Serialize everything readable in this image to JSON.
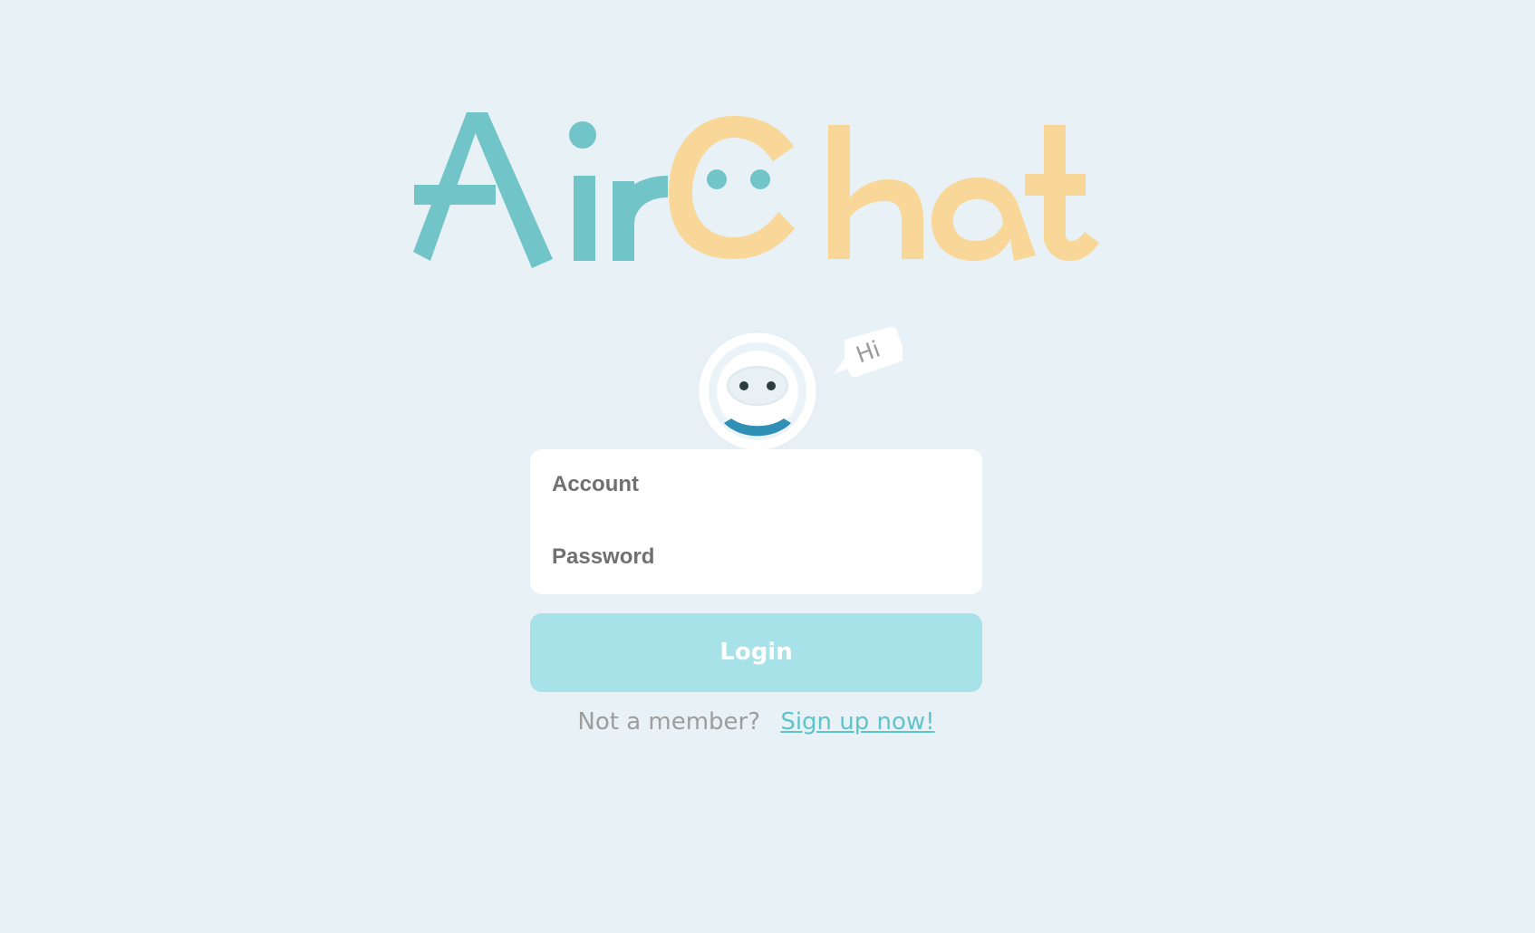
{
  "app": {
    "name": "AirChat",
    "logo_icon": "airchat-logo",
    "colors": {
      "background": "#e8f1f6",
      "logo_teal": "#71c4c8",
      "logo_yellow": "#f8d799",
      "mascot_mouth": "#2f8fb5",
      "button_fill": "#a7e2e8",
      "link": "#5ec4cc"
    }
  },
  "mascot": {
    "icon": "robot-mascot-icon",
    "greeting": "Hi"
  },
  "form": {
    "account_placeholder": "Account",
    "password_placeholder": "Password",
    "login_label": "Login"
  },
  "signup": {
    "prompt": "Not a member?",
    "link_label": "Sign up now!"
  }
}
